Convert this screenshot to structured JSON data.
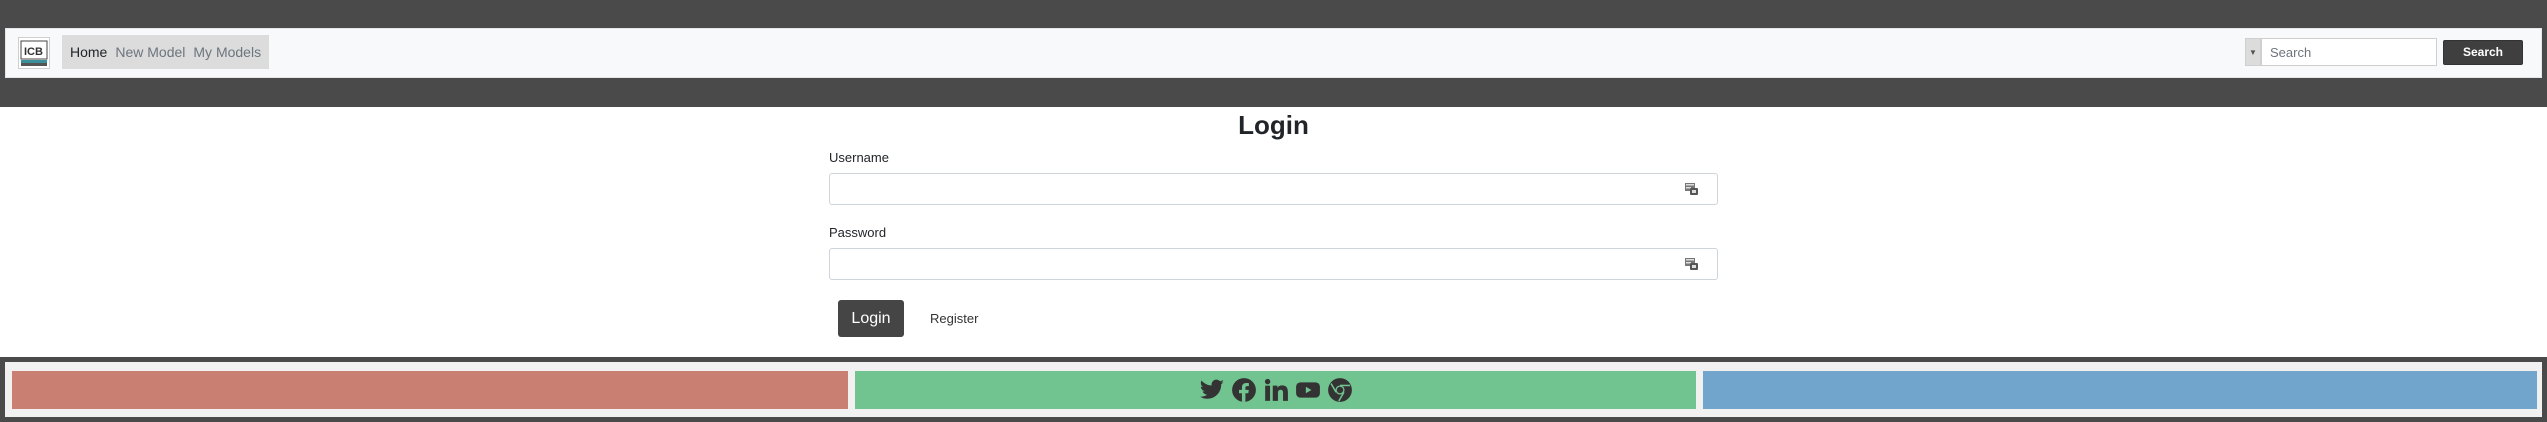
{
  "navbar": {
    "logo": "site-logo",
    "links": [
      {
        "label": "Home",
        "active": true
      },
      {
        "label": "New Model",
        "active": false
      },
      {
        "label": "My Models",
        "active": false
      }
    ],
    "search": {
      "placeholder": "Search",
      "value": "",
      "button_label": "Search"
    }
  },
  "main": {
    "title": "Login",
    "username_label": "Username",
    "username_value": "",
    "password_label": "Password",
    "password_value": "",
    "login_label": "Login",
    "register_label": "Register"
  },
  "footer": {
    "colors": {
      "left": "#c98073",
      "center": "#71c490",
      "right": "#72a5cb"
    },
    "social_icons": [
      "twitter-icon",
      "facebook-icon",
      "linkedin-icon",
      "youtube-icon",
      "chrome-web-icon"
    ]
  },
  "colors": {
    "header_band": "#4a4a4a",
    "navbar_bg": "#f8f9fa",
    "button_dark": "#454545"
  }
}
